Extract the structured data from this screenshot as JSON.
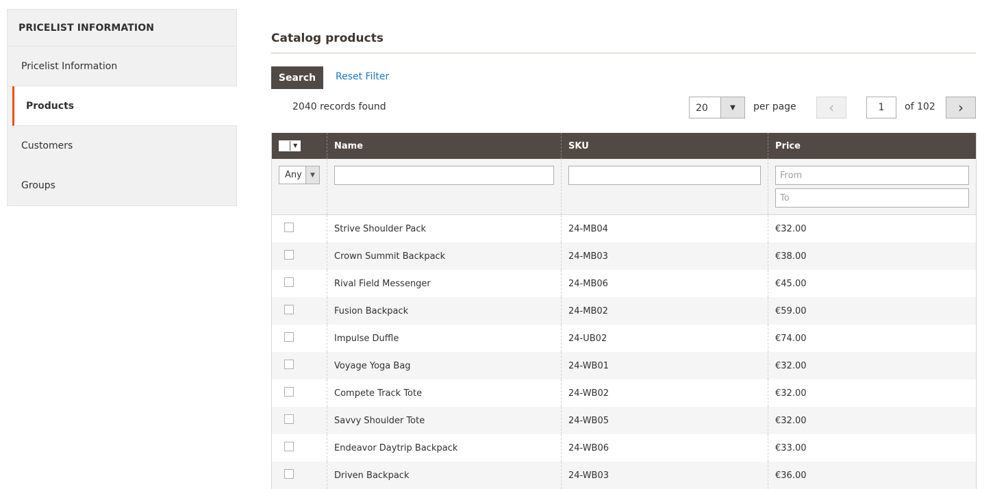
{
  "sidebar": {
    "title": "PRICELIST INFORMATION",
    "items": [
      {
        "label": "Pricelist Information"
      },
      {
        "label": "Products"
      },
      {
        "label": "Customers"
      },
      {
        "label": "Groups"
      }
    ]
  },
  "main": {
    "section_title": "Catalog products",
    "search_label": "Search",
    "reset_label": "Reset Filter",
    "records": "2040 records found",
    "per_page_value": "20",
    "per_page_label": "per page",
    "page_current": "1",
    "page_total": "of 102"
  },
  "grid": {
    "columns": [
      "Name",
      "SKU",
      "Price"
    ],
    "filters": {
      "visibility": "Any",
      "price_from_placeholder": "From",
      "price_to_placeholder": "To"
    },
    "rows": [
      {
        "name": "Strive Shoulder Pack",
        "sku": "24-MB04",
        "price": "€32.00"
      },
      {
        "name": "Crown Summit Backpack",
        "sku": "24-MB03",
        "price": "€38.00"
      },
      {
        "name": "Rival Field Messenger",
        "sku": "24-MB06",
        "price": "€45.00"
      },
      {
        "name": "Fusion Backpack",
        "sku": "24-MB02",
        "price": "€59.00"
      },
      {
        "name": "Impulse Duffle",
        "sku": "24-UB02",
        "price": "€74.00"
      },
      {
        "name": "Voyage Yoga Bag",
        "sku": "24-WB01",
        "price": "€32.00"
      },
      {
        "name": "Compete Track Tote",
        "sku": "24-WB02",
        "price": "€32.00"
      },
      {
        "name": "Savvy Shoulder Tote",
        "sku": "24-WB05",
        "price": "€32.00"
      },
      {
        "name": "Endeavor Daytrip Backpack",
        "sku": "24-WB06",
        "price": "€33.00"
      },
      {
        "name": "Driven Backpack",
        "sku": "24-WB03",
        "price": "€36.00"
      }
    ]
  },
  "colors": {
    "header_bg": "#514943",
    "accent": "#eb5202",
    "link": "#1979c3"
  }
}
